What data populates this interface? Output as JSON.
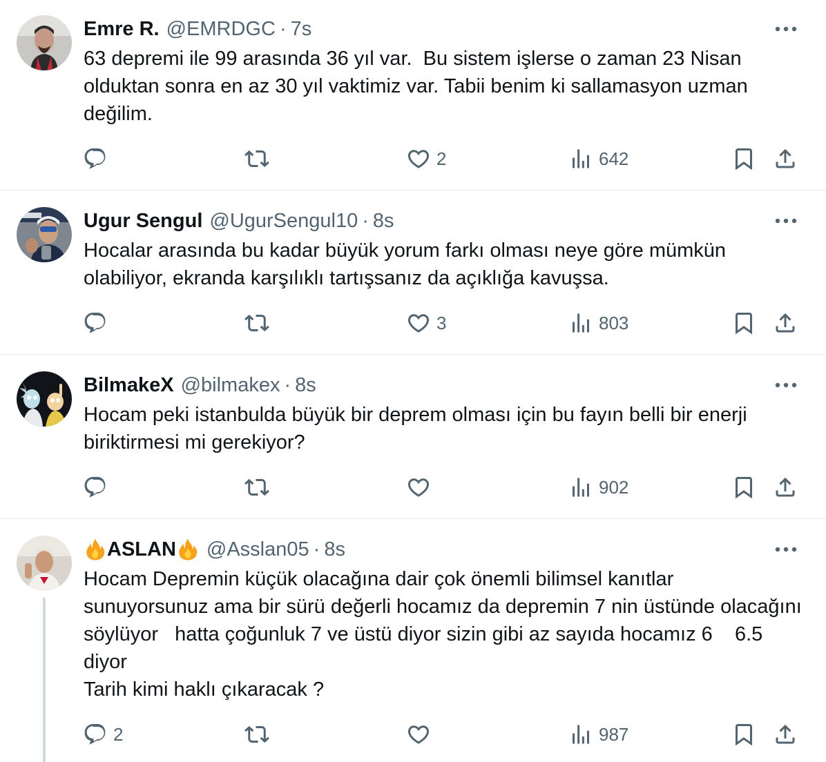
{
  "colors": {
    "text": "#0f1419",
    "secondary": "#536471",
    "divider": "#e7e9ea",
    "thread_line": "#cfd9de"
  },
  "tweets": [
    {
      "name": "Emre R.",
      "handle": "@EMRDGC",
      "time": "7s",
      "text": "63 depremi ile 99 arasında 36 yıl var.  Bu sistem işlerse o zaman 23 Nisan olduktan sonra en az 30 yıl vaktimiz var. Tabii benim ki sallamasyon uzman değilim.",
      "replies": "",
      "retweets": "",
      "likes": "2",
      "views": "642"
    },
    {
      "name": "Ugur Sengul",
      "handle": "@UgurSengul10",
      "time": "8s",
      "text": "Hocalar arasında bu kadar büyük yorum farkı olması neye göre mümkün olabiliyor, ekranda karşılıklı tartışsanız da açıklığa kavuşsa.",
      "replies": "",
      "retweets": "",
      "likes": "3",
      "views": "803"
    },
    {
      "name": "BilmakeX",
      "handle": "@bilmakex",
      "time": "8s",
      "text": "Hocam peki istanbulda büyük bir deprem olması için bu fayın belli bir enerji biriktirmesi mi gerekiyor?",
      "replies": "",
      "retweets": "",
      "likes": "",
      "views": "902"
    },
    {
      "name": "ASLAN",
      "handle": "@Asslan05",
      "time": "8s",
      "text": "Hocam Depremin küçük olacağına dair çok önemli bilimsel kanıtlar sunuyorsunuz ama bir sürü değerli hocamız da depremin 7 nin üstünde olacağını söylüyor   hatta çoğunluk 7 ve üstü diyor sizin gibi az sayıda hocamız 6    6.5 diyor\nTarih kimi haklı çıkaracak ?",
      "replies": "2",
      "retweets": "",
      "likes": "",
      "views": "987"
    }
  ]
}
